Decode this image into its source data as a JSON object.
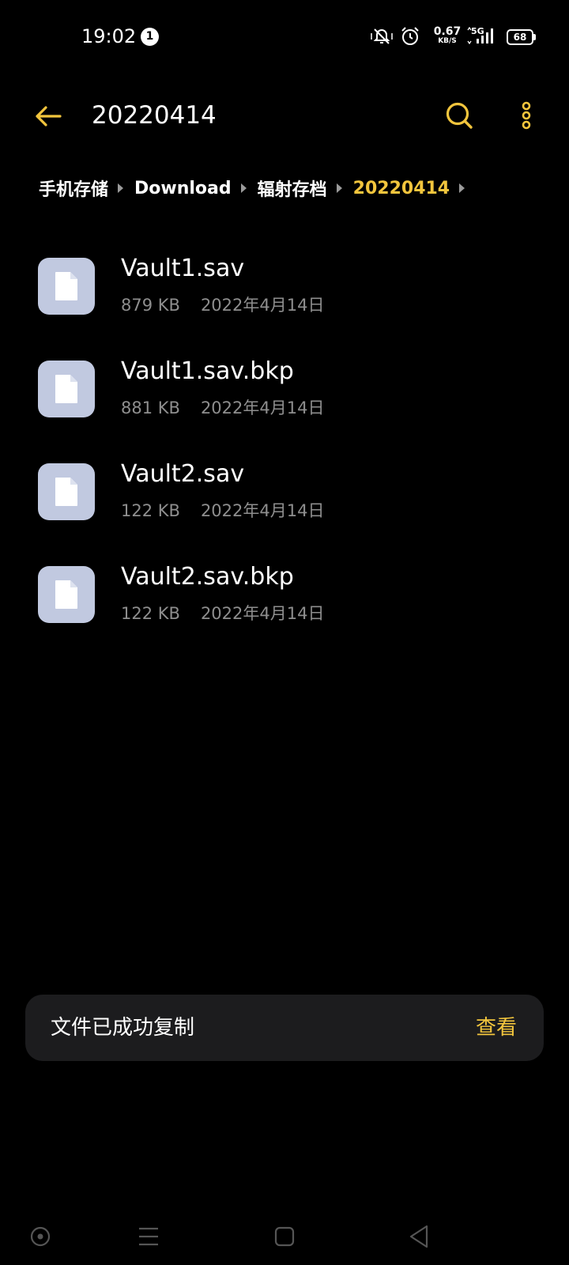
{
  "status_bar": {
    "time": "19:02",
    "notification_count": "1",
    "net_speed_value": "0.67",
    "net_speed_unit": "KB/S",
    "network_type": "5G",
    "battery_level": "68"
  },
  "app_bar": {
    "title": "20220414",
    "back_icon": "arrow-left-icon",
    "search_icon": "search-icon",
    "more_icon": "more-vertical-icon"
  },
  "breadcrumb": [
    {
      "label": "手机存储"
    },
    {
      "label": "Download"
    },
    {
      "label": "辐射存档"
    },
    {
      "label": "20220414"
    }
  ],
  "files": [
    {
      "name": "Vault1.sav",
      "size": "879 KB",
      "date": "2022年4月14日"
    },
    {
      "name": "Vault1.sav.bkp",
      "size": "881 KB",
      "date": "2022年4月14日"
    },
    {
      "name": "Vault2.sav",
      "size": "122 KB",
      "date": "2022年4月14日"
    },
    {
      "name": "Vault2.sav.bkp",
      "size": "122 KB",
      "date": "2022年4月14日"
    }
  ],
  "snackbar": {
    "message": "文件已成功复制",
    "action": "查看"
  },
  "nav_bar": {
    "icons": [
      "record-icon",
      "menu-icon",
      "home-square-icon",
      "back-triangle-icon"
    ]
  },
  "colors": {
    "background": "#000000",
    "accent": "#f2c53d",
    "file_icon_bg": "#c1c9e0",
    "secondary_text": "#8e8e8e",
    "snackbar_bg": "#1c1c1e"
  }
}
